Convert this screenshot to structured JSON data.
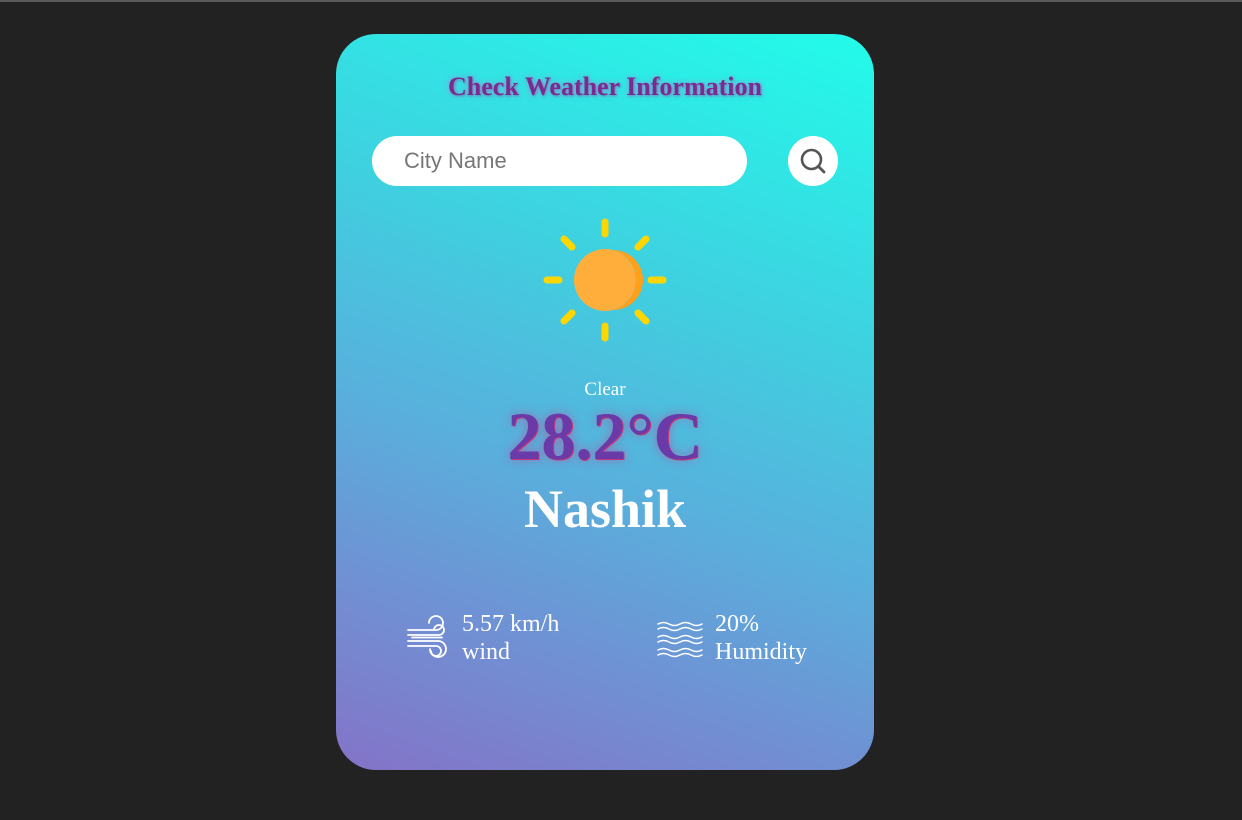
{
  "app": {
    "title": "Check Weather Information"
  },
  "search": {
    "placeholder": "City Name",
    "value": "",
    "button_icon": "search-icon"
  },
  "weather": {
    "icon": "sun-icon",
    "condition": "Clear",
    "temperature": "28.2°C",
    "city": "Nashik"
  },
  "details": {
    "wind": {
      "icon": "wind-icon",
      "value": "5.57 km/h",
      "label": "wind"
    },
    "humidity": {
      "icon": "humidity-icon",
      "value": "20%",
      "label": "Humidity"
    }
  },
  "colors": {
    "background": "#222222",
    "card_gradient_top": "#22fcea",
    "card_gradient_bottom": "#8473c8",
    "title_color": "#7a2b8f",
    "temperature_color": "#6a3aa8",
    "sun_core": "#ffae3b",
    "sun_rays": "#ffd600"
  }
}
